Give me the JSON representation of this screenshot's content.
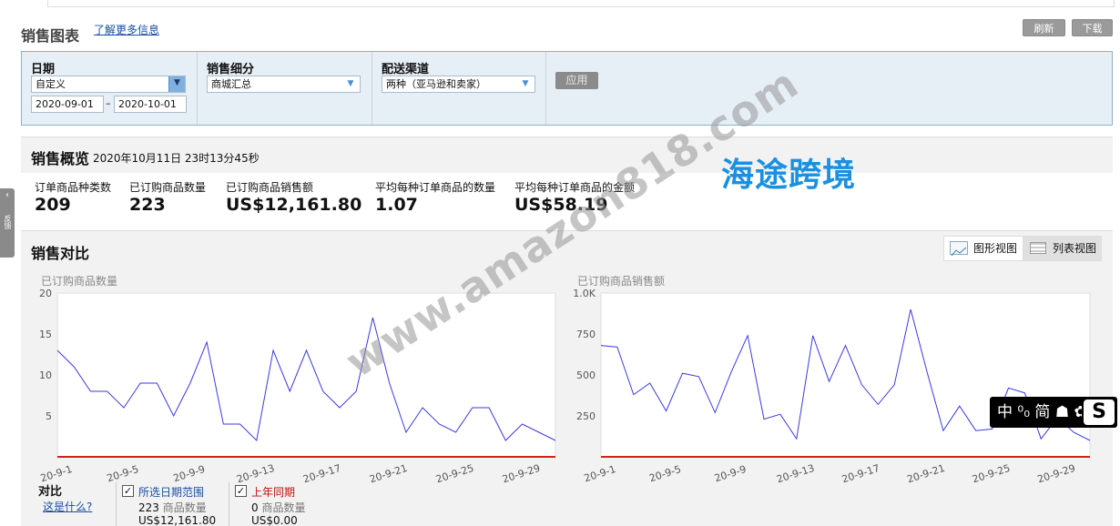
{
  "header": {
    "title": "销售图表",
    "more_link": "了解更多信息",
    "refresh": "刷新",
    "download": "下载"
  },
  "filters": {
    "date": {
      "label": "日期",
      "value": "自定义",
      "from": "2020-09-01",
      "sep": "–",
      "to": "2020-10-01"
    },
    "breakdown": {
      "label": "销售细分",
      "value": "商城汇总"
    },
    "channel": {
      "label": "配送渠道",
      "value": "两种（亚马逊和卖家）"
    },
    "apply": "应用"
  },
  "overview": {
    "title": "销售概览",
    "timestamp": "2020年10月11日 23时13分45秒",
    "brand_watermark": "海途跨境",
    "metrics": [
      {
        "label": "订单商品种类数",
        "value": "209"
      },
      {
        "label": "已订购商品数量",
        "value": "223"
      },
      {
        "label": "已订购商品销售额",
        "value": "US$12,161.80"
      },
      {
        "label": "平均每种订单商品的数量",
        "value": "1.07"
      },
      {
        "label": "平均每种订单商品的金额",
        "value": "US$58.19"
      }
    ]
  },
  "compare": {
    "title": "销售对比",
    "graph_view": "图形视图",
    "list_view": "列表视图",
    "legend_title": "对比",
    "whats_this": "这是什么?",
    "current": {
      "label": "所选日期范围",
      "qty_num": "223",
      "qty_label": "商品数量",
      "amount": "US$12,161.80"
    },
    "last_year": {
      "label": "上年同期",
      "qty_num": "0",
      "qty_label": "商品数量",
      "amount": "US$0.00"
    }
  },
  "diag_watermark": "www.amazon818.com",
  "side_tab": "反馈",
  "ime": {
    "text": "中 ⁰₀ 简 ☗ ✿",
    "logo": "S"
  },
  "colors": {
    "series_current": "#3a3ae0",
    "series_last_year": "#d02020"
  },
  "chart_data": [
    {
      "type": "line",
      "title": "已订购商品数量",
      "x_ticks": [
        "20-9-1",
        "20-9-5",
        "20-9-9",
        "20-9-13",
        "20-9-17",
        "20-9-21",
        "20-9-25",
        "20-9-29"
      ],
      "y_ticks": [
        "20",
        "15",
        "10",
        "5"
      ],
      "ylim": [
        0,
        20
      ],
      "grid": false,
      "series": [
        {
          "name": "所选日期范围",
          "values": [
            13,
            11,
            8,
            8,
            6,
            9,
            9,
            5,
            9,
            14,
            4,
            4,
            2,
            13,
            8,
            13,
            8,
            6,
            8,
            17,
            9,
            3,
            6,
            4,
            3,
            6,
            6,
            2,
            4,
            3,
            2
          ]
        },
        {
          "name": "上年同期",
          "values": [
            0,
            0,
            0,
            0,
            0,
            0,
            0,
            0,
            0,
            0,
            0,
            0,
            0,
            0,
            0,
            0,
            0,
            0,
            0,
            0,
            0,
            0,
            0,
            0,
            0,
            0,
            0,
            0,
            0,
            0,
            0
          ]
        }
      ]
    },
    {
      "type": "line",
      "title": "已订购商品销售额",
      "x_ticks": [
        "20-9-1",
        "20-9-5",
        "20-9-9",
        "20-9-13",
        "20-9-17",
        "20-9-21",
        "20-9-25",
        "20-9-29"
      ],
      "y_ticks": [
        "1.0K",
        "750",
        "500",
        "250"
      ],
      "ylim": [
        0,
        1000
      ],
      "grid": false,
      "series": [
        {
          "name": "所选日期范围",
          "values": [
            680,
            670,
            380,
            450,
            280,
            510,
            490,
            270,
            520,
            740,
            230,
            260,
            110,
            740,
            460,
            680,
            440,
            320,
            440,
            900,
            520,
            160,
            310,
            160,
            170,
            420,
            390,
            110,
            240,
            150,
            100
          ]
        },
        {
          "name": "上年同期",
          "values": [
            0,
            0,
            0,
            0,
            0,
            0,
            0,
            0,
            0,
            0,
            0,
            0,
            0,
            0,
            0,
            0,
            0,
            0,
            0,
            0,
            0,
            0,
            0,
            0,
            0,
            0,
            0,
            0,
            0,
            0,
            0
          ]
        }
      ]
    }
  ]
}
